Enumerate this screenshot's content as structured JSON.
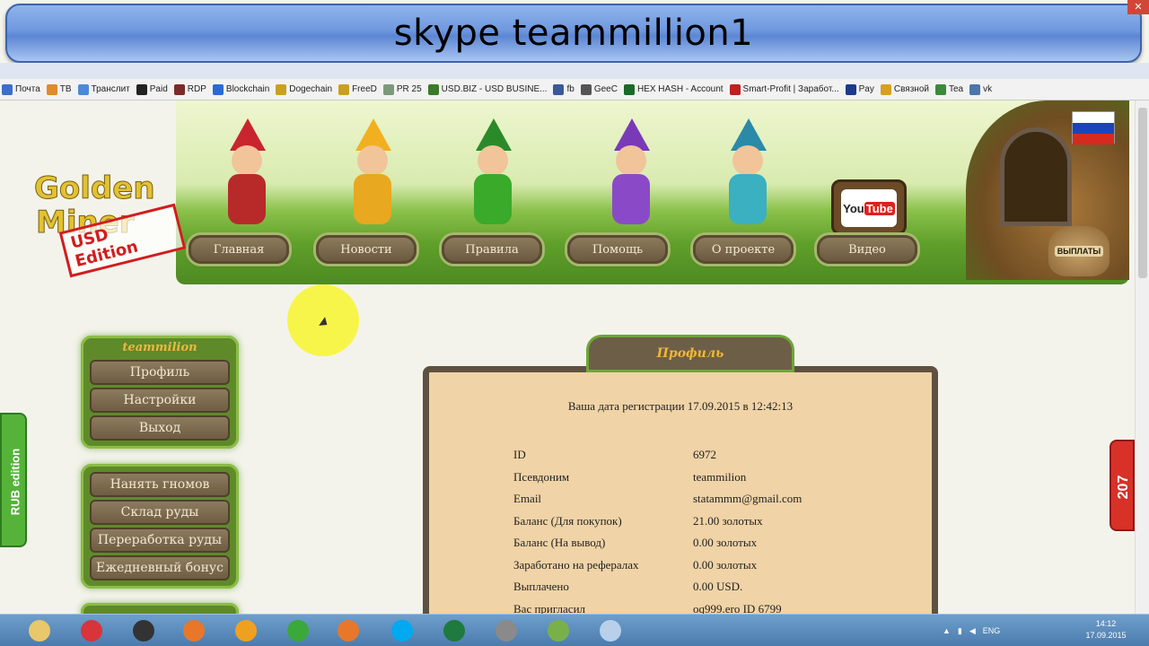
{
  "overlay": {
    "text": "skype teammillion1"
  },
  "bookmarks": [
    {
      "label": "Почта",
      "color": "#3b6fc9"
    },
    {
      "label": "ТВ",
      "color": "#e08a2a"
    },
    {
      "label": "Транслит",
      "color": "#4a8ad8"
    },
    {
      "label": "Paid",
      "color": "#222222"
    },
    {
      "label": "RDP",
      "color": "#7a2a2a"
    },
    {
      "label": "Blockchain",
      "color": "#2a6ad8"
    },
    {
      "label": "Dogechain",
      "color": "#c9a020"
    },
    {
      "label": "FreeD",
      "color": "#c9a020"
    },
    {
      "label": "PR 25",
      "color": "#7a9a7a"
    },
    {
      "label": "USD.BIZ - USD BUSINE...",
      "color": "#3a7a2a"
    },
    {
      "label": "fb",
      "color": "#3b5998"
    },
    {
      "label": "GeeC",
      "color": "#555555"
    },
    {
      "label": "HEX HASH - Account",
      "color": "#1a6a2a"
    },
    {
      "label": "Smart-Profit | Заработ...",
      "color": "#c02020"
    },
    {
      "label": "Pay",
      "color": "#1a3a8a"
    },
    {
      "label": "Связной",
      "color": "#d8a020"
    },
    {
      "label": "Tea",
      "color": "#3a8a3a"
    },
    {
      "label": "vk",
      "color": "#4a76a8"
    }
  ],
  "logo": {
    "line1": "Golden",
    "line2": "Miner",
    "stamp": "USD Edition"
  },
  "nav": [
    {
      "label": "Главная"
    },
    {
      "label": "Новости"
    },
    {
      "label": "Правила"
    },
    {
      "label": "Помощь"
    },
    {
      "label": "О проекте"
    },
    {
      "label": "Видео"
    }
  ],
  "banner": {
    "tv_label_a": "You",
    "tv_label_b": "Tube",
    "bag_label": "ВЫПЛАТЫ"
  },
  "user_menu": {
    "title": "teammilion",
    "items": [
      "Профиль",
      "Настройки",
      "Выход"
    ]
  },
  "game_menu": {
    "items": [
      "Нанять гномов",
      "Склад руды",
      "Переработка руды",
      "Ежедневный бонус"
    ]
  },
  "side_tabs": {
    "left": "RUB edition",
    "right": "207"
  },
  "profile": {
    "tab_title": "Профиль",
    "reg_date": "Ваша дата регистрации 17.09.2015 в 12:42:13",
    "rows": [
      {
        "key": "ID",
        "value": "6972"
      },
      {
        "key": "Псевдоним",
        "value": "teammilion"
      },
      {
        "key": "Email",
        "value": "statammm@gmail.com"
      },
      {
        "key": "Баланс (Для покупок)",
        "value": "21.00 золотых"
      },
      {
        "key": "Баланс (На вывод)",
        "value": "0.00 золотых"
      },
      {
        "key": "Заработано на рефералах",
        "value": "0.00 золотых"
      },
      {
        "key": "Выплачено",
        "value": "0.00 USD."
      },
      {
        "key": "Вас пригласил",
        "value": "oq999.ero ID 6799"
      }
    ]
  },
  "taskbar": {
    "lang": "ENG",
    "time": "14:12",
    "date": "17.09.2015",
    "apps": [
      {
        "name": "explorer",
        "color": "#e8c86a"
      },
      {
        "name": "app-red",
        "color": "#d8343a"
      },
      {
        "name": "app-dark",
        "color": "#333333"
      },
      {
        "name": "firefox",
        "color": "#e8772a"
      },
      {
        "name": "app-orange",
        "color": "#f0a020"
      },
      {
        "name": "chrome",
        "color": "#3aa83a"
      },
      {
        "name": "firefox-2",
        "color": "#e8772a"
      },
      {
        "name": "skype",
        "color": "#00a9f0"
      },
      {
        "name": "excel",
        "color": "#1e7a3e"
      },
      {
        "name": "app-gray",
        "color": "#8a8a8a"
      },
      {
        "name": "app-green",
        "color": "#7ab04a"
      },
      {
        "name": "app-blue",
        "color": "#b8d0ea"
      }
    ]
  }
}
